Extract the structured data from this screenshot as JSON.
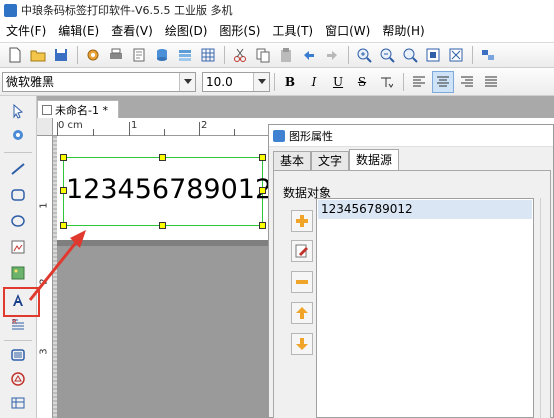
{
  "window": {
    "title": "中琅条码标签打印软件-V6.5.5 工业版 多机"
  },
  "menu": [
    "文件(F)",
    "编辑(E)",
    "查看(V)",
    "绘图(D)",
    "图形(S)",
    "工具(T)",
    "窗口(W)",
    "帮助(H)"
  ],
  "format_bar": {
    "font_name": "微软雅黑",
    "font_size": "10.0",
    "bold": "B",
    "italic": "I",
    "underline": "U",
    "strike": "S"
  },
  "document": {
    "tab_label": "未命名-1 *",
    "ruler_h": [
      "0 cm",
      "1",
      "2"
    ],
    "ruler_v": [
      "1",
      "2",
      "3"
    ],
    "barcode_text": "123456789012"
  },
  "dialog": {
    "title": "图形属性",
    "tabs": [
      "基本",
      "文字",
      "数据源"
    ],
    "active_tab": "数据源",
    "group_label": "数据对象",
    "data_objects": [
      "123456789012"
    ]
  },
  "colors": {
    "highlight": "#e03a2f",
    "selection": "#2fc63a",
    "handle": "#ffff00",
    "list_selected": "#dbe6f4"
  }
}
